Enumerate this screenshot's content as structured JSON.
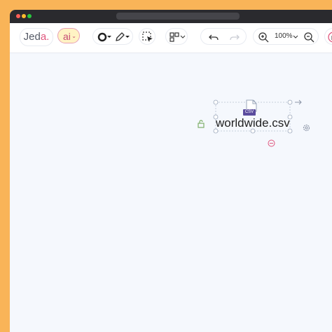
{
  "app": {
    "logo_main": "Jed",
    "logo_accent": "a.",
    "ai_label": "ai"
  },
  "toolbar": {
    "zoom_level": "100%"
  },
  "canvas": {
    "file_name": "worldwide.csv",
    "file_badge": "CSV"
  },
  "colors": {
    "background": "#F9B458",
    "ai_pill": "#FFF3C4",
    "accent": "#E0567D",
    "badge": "#5B4C9E"
  }
}
